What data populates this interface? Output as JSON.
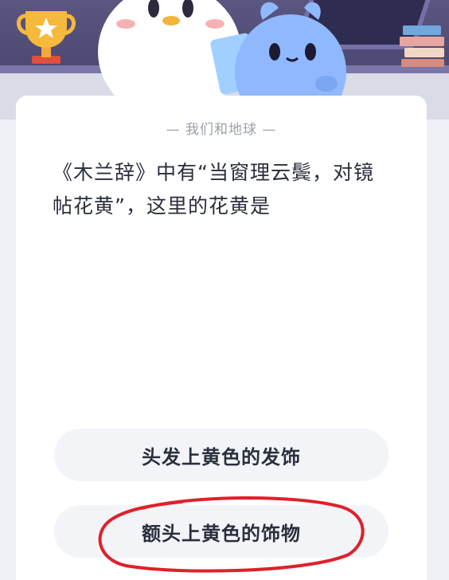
{
  "card": {
    "tag": "— 我们和地球 —",
    "question": "《木兰辞》中有“当窗理云鬓，对镜帖花黄”，这里的花黄是"
  },
  "options": [
    {
      "label": "头发上黄色的发饰"
    },
    {
      "label": "额头上黄色的饰物"
    }
  ],
  "annotation": {
    "color": "#e0202a"
  },
  "colors": {
    "banner": "#4b4872",
    "card_bg": "#ffffff",
    "option_bg": "#f2f4f8",
    "text": "#2a2f3c",
    "tag_text": "#9aa0ad"
  }
}
